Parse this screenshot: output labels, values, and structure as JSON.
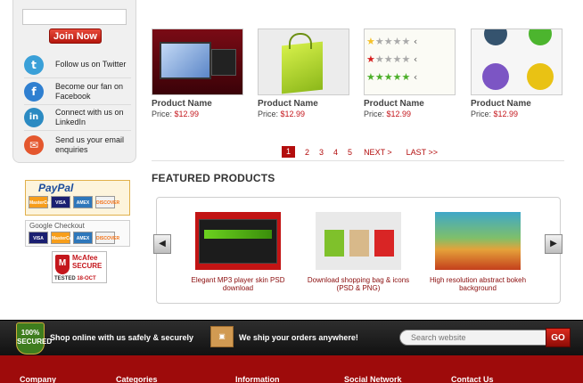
{
  "sidebar": {
    "join_label": "Join Now",
    "social": [
      {
        "icon": "twitter-icon",
        "glyph": "t",
        "color": "#3aa0d8",
        "label": "Follow us on Twitter"
      },
      {
        "icon": "facebook-icon",
        "glyph": "f",
        "color": "#2f7fd0",
        "label": "Become our fan on Facebook"
      },
      {
        "icon": "linkedin-icon",
        "glyph": "in",
        "color": "#2b8ac2",
        "label": "Connect with us on LinkedIn"
      },
      {
        "icon": "email-icon",
        "glyph": "✉",
        "color": "#e4572e",
        "label": "Send us your email enquiries"
      }
    ]
  },
  "badges": {
    "paypal": "PayPal",
    "paypal_cards": [
      "MasterCard",
      "VISA",
      "AMEX",
      "DISCOVER"
    ],
    "google_checkout": "Google Checkout",
    "google_cards": [
      "VISA",
      "MasterCard",
      "AMEX",
      "DISCOVER"
    ],
    "mcafee_title": "McAfee SECURE",
    "mcafee_tested": "TESTED",
    "mcafee_date": "18-OCT"
  },
  "products": [
    {
      "name": "Product Name",
      "price_label": "Price:",
      "price": "$12.99",
      "thumb": "monitor-thumb"
    },
    {
      "name": "Product Name",
      "price_label": "Price:",
      "price": "$12.99",
      "thumb": "bag-thumb"
    },
    {
      "name": "Product Name",
      "price_label": "Price:",
      "price": "$12.99",
      "thumb": "stars-thumb"
    },
    {
      "name": "Product Name",
      "price_label": "Price:",
      "price": "$12.99",
      "thumb": "social-icons-thumb"
    }
  ],
  "pagination": {
    "pages": [
      "1",
      "2",
      "3",
      "4",
      "5"
    ],
    "active": "1",
    "next": "NEXT >",
    "last": "LAST >>"
  },
  "featured": {
    "title": "FEATURED PRODUCTS",
    "items": [
      {
        "caption": "Elegant MP3 player skin PSD download",
        "thumb": "mp3-player-thumb"
      },
      {
        "caption": "Download shopping bag & icons (PSD & PNG)",
        "thumb": "shopping-bags-thumb"
      },
      {
        "caption": "High resolution abstract bokeh background",
        "thumb": "bokeh-thumb"
      }
    ],
    "prev_arrow": "◀",
    "next_arrow": "▶"
  },
  "trustbar": {
    "secured_badge": "100% SECURED",
    "secure_text": "Shop online with us safely & securely",
    "ship_text": "We ship your orders anywhere!",
    "search_placeholder": "Search website",
    "go_label": "GO"
  },
  "footer": {
    "headings": [
      "Company",
      "Categories",
      "Information",
      "Social Network",
      "Contact Us"
    ]
  },
  "colors": {
    "accent": "#b30d0d",
    "footer": "#9e0b0b",
    "price": "#c4161c"
  }
}
